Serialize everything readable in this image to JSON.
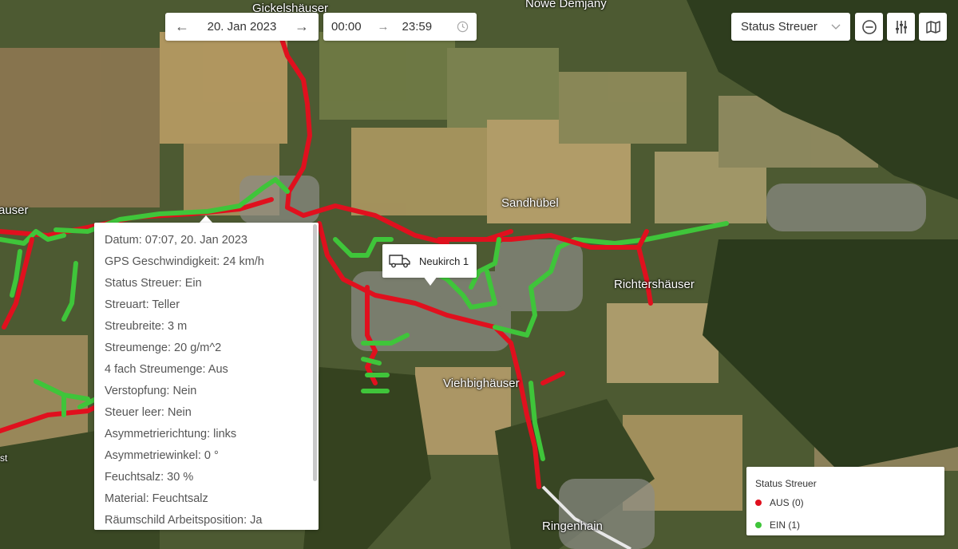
{
  "date_nav": {
    "prev_icon": "arrow-left-icon",
    "date": "20. Jan 2023",
    "next_icon": "arrow-right-icon"
  },
  "time_nav": {
    "start": "00:00",
    "end": "23:59",
    "clock_icon": "clock-icon"
  },
  "filter": {
    "selected": "Status Streuer"
  },
  "toolbar": {
    "buttons": [
      "minus-circle-icon",
      "sliders-icon",
      "map-icon"
    ]
  },
  "places": [
    {
      "name": "Gickelshäuser"
    },
    {
      "name": "Nowe Demjany"
    },
    {
      "name": "Sandhübel"
    },
    {
      "name": "Richtershäuser"
    },
    {
      "name": "Viehbighäuser"
    },
    {
      "name": "Ringenhain"
    },
    {
      "name": "auser"
    },
    {
      "name": "st"
    }
  ],
  "tooltip": {
    "rows": [
      "Datum: 07:07, 20. Jan 2023",
      "GPS Geschwindigkeit: 24 km/h",
      "Status Streuer: Ein",
      "Streuart: Teller",
      "Streubreite: 3 m",
      "Streumenge: 20 g/m^2",
      "4 fach Streumenge: Aus",
      "Verstopfung: Nein",
      "Steuer leer: Nein",
      "Asymmetrierichtung: links",
      "Asymmetriewinkel: 0 °",
      "Feuchtsalz: 30 %",
      "Material: Feuchtsalz",
      "Räumschild Arbeitsposition: Ja"
    ]
  },
  "vehicle": {
    "label": "Neukirch 1",
    "icon": "truck-icon"
  },
  "legend": {
    "title": "Status Streuer",
    "items": [
      {
        "label": "AUS (0)",
        "color": "#e0101e"
      },
      {
        "label": "EIN (1)",
        "color": "#3fc53a"
      }
    ]
  },
  "colors": {
    "off": "#e0101e",
    "on": "#3fc53a"
  }
}
